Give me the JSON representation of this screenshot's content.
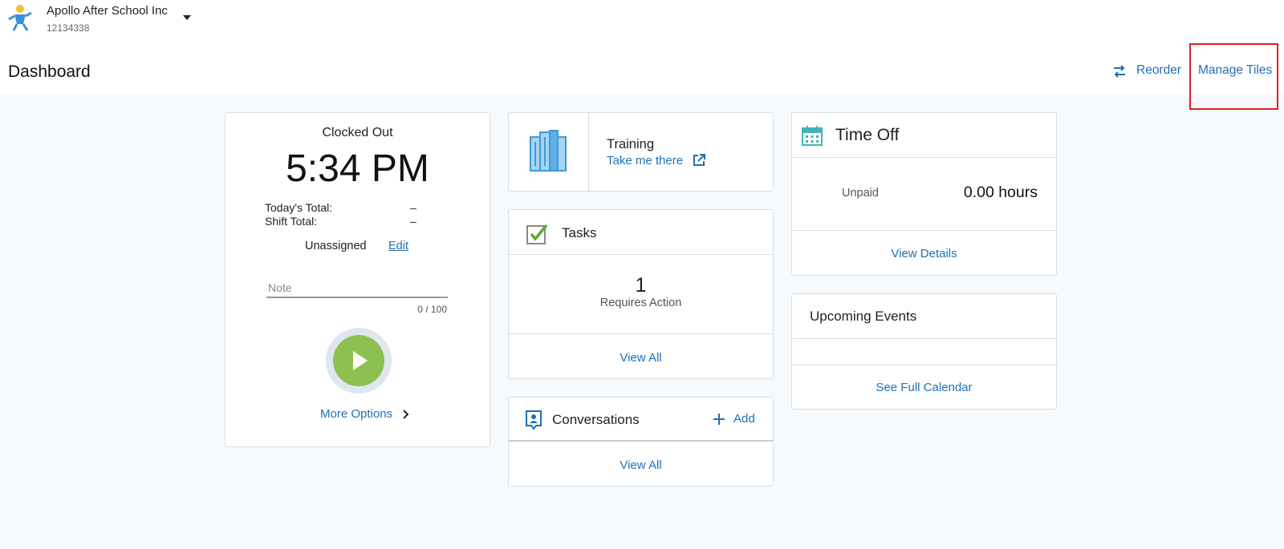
{
  "header": {
    "company_name": "Apollo After School Inc",
    "company_id": "12134338",
    "page_title": "Dashboard",
    "reorder_label": "Reorder",
    "manage_tiles_label": "Manage Tiles"
  },
  "clock_tile": {
    "status": "Clocked Out",
    "time": "5:34 PM",
    "todays_total_label": "Today's Total:",
    "todays_total_value": "–",
    "shift_total_label": "Shift Total:",
    "shift_total_value": "–",
    "assignment": "Unassigned",
    "edit_label": "Edit",
    "note_placeholder": "Note",
    "note_counter": "0 / 100",
    "more_options_label": "More Options"
  },
  "training_tile": {
    "title": "Training",
    "link_label": "Take me there"
  },
  "tasks_tile": {
    "title": "Tasks",
    "count": "1",
    "subtitle": "Requires Action",
    "view_all_label": "View All"
  },
  "conversations_tile": {
    "title": "Conversations",
    "add_label": "Add",
    "view_all_label": "View All"
  },
  "time_off_tile": {
    "title": "Time Off",
    "balance_label": "Unpaid",
    "balance_value": "0.00 hours",
    "view_details_label": "View Details"
  },
  "events_tile": {
    "title": "Upcoming Events",
    "calendar_label": "See Full Calendar"
  },
  "colors": {
    "accent": "#1f6fb8",
    "play_button": "#8cc152",
    "highlight_box": "#e02020",
    "background": "#f7fafd"
  },
  "icons": [
    "company-logo-icon",
    "caret-down-icon",
    "reorder-icon",
    "play-icon",
    "chevron-right-icon",
    "books-icon",
    "external-link-icon",
    "checkbox-checked-icon",
    "conversation-icon",
    "plus-icon",
    "calendar-icon"
  ]
}
